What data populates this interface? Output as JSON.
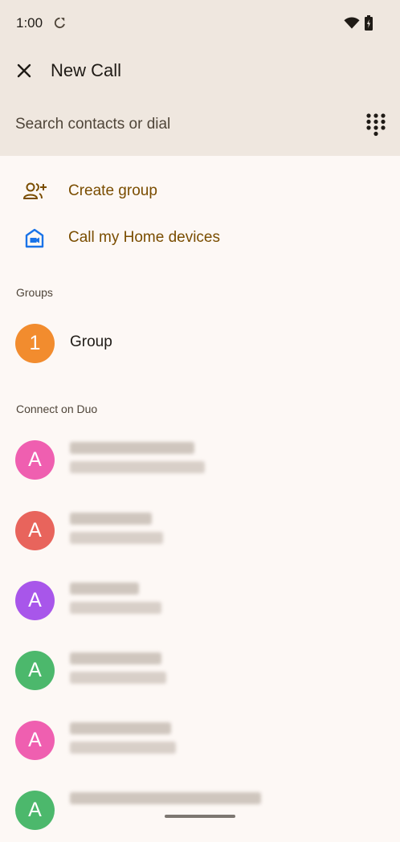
{
  "status_bar": {
    "time": "1:00",
    "icons": [
      "sync-icon",
      "wifi-icon",
      "battery-icon"
    ]
  },
  "app_bar": {
    "title": "New Call",
    "close_icon": "close-icon"
  },
  "search": {
    "placeholder": "Search contacts or dial",
    "value": "",
    "dialpad_icon": "dialpad-icon"
  },
  "actions": [
    {
      "label": "Create group",
      "icon": "group-add-icon"
    },
    {
      "label": "Call my Home devices",
      "icon": "home-device-icon"
    }
  ],
  "groups_section": {
    "title": "Groups",
    "items": [
      {
        "initial": "1",
        "name": "Group",
        "color": "#f28c2e"
      }
    ]
  },
  "connect_section": {
    "title": "Connect on Duo",
    "contacts": [
      {
        "initial": "A",
        "color": "#ef5fb0"
      },
      {
        "initial": "A",
        "color": "#e8645c"
      },
      {
        "initial": "A",
        "color": "#a856ea"
      },
      {
        "initial": "A",
        "color": "#4cb86c"
      },
      {
        "initial": "A",
        "color": "#ef5fb0"
      },
      {
        "initial": "A",
        "color": "#4cb86c"
      }
    ]
  },
  "colors": {
    "header_bg": "#efe7df",
    "page_bg": "#fdf8f5",
    "accent_text": "#7a4d00",
    "home_icon": "#1a73e8"
  }
}
